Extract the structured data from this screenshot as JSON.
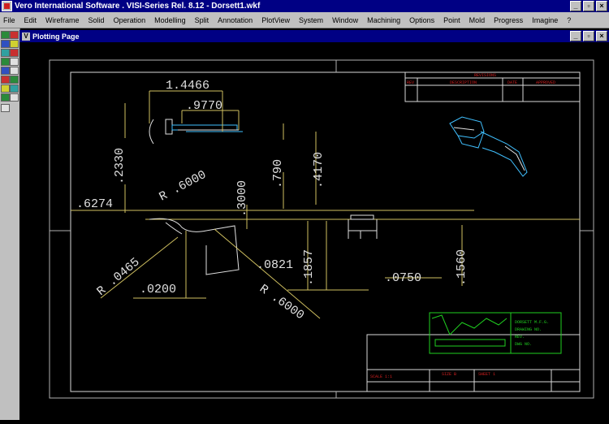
{
  "window": {
    "title": "Vero International Software . VISI-Series Rel. 8.12 - Dorsett1.wkf"
  },
  "menu": [
    "File",
    "Edit",
    "Wireframe",
    "Solid",
    "Operation",
    "Modelling",
    "Split",
    "Annotation",
    "PlotView",
    "System",
    "Window",
    "Machining",
    "Options",
    "Point",
    "Mold",
    "Progress",
    "Imagine",
    "?"
  ],
  "child_window": {
    "title": "Plotting Page"
  },
  "drawing": {
    "dimensions": [
      "1.4466",
      ".9770",
      ".2330",
      ".6274",
      "R .6000",
      ".3000",
      ".790",
      ".4170",
      "R .0465",
      ".0200",
      ".0821",
      ".1857",
      "R .6000",
      ".0750",
      ".1560"
    ],
    "revisions_block": {
      "title": "REVISIONS",
      "columns": [
        "REV",
        "DESCRIPTION",
        "DATE",
        "APPROVED"
      ]
    },
    "title_block": {
      "company_lines": [
        "DORSETT M.F.G.",
        "DRAWING NO.",
        "REV.",
        "DWG NO."
      ],
      "footer_left": "SCALE 1:1",
      "footer_mid": "SIZE B",
      "footer_right": "SHEET 1"
    }
  }
}
